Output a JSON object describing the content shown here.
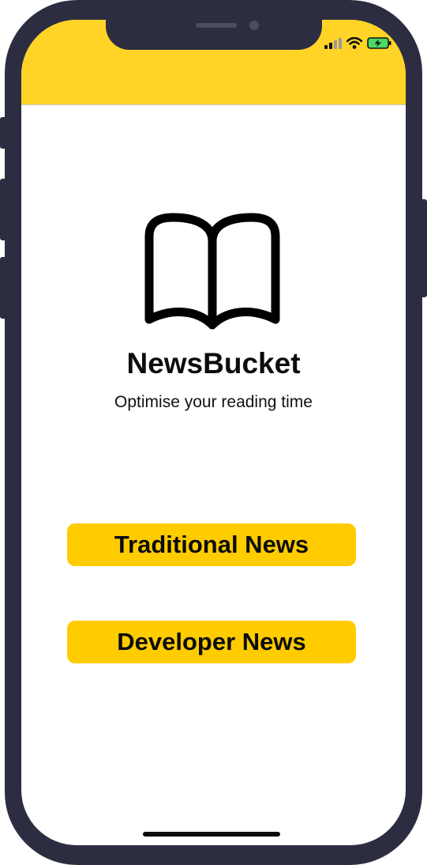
{
  "app": {
    "title": "NewsBucket",
    "tagline": "Optimise your reading time",
    "logo_icon": "open-book-icon"
  },
  "status_bar": {
    "signal_icon": "cellular-signal-icon",
    "wifi_icon": "wifi-icon",
    "battery_icon": "battery-charging-icon"
  },
  "actions": {
    "traditional_label": "Traditional News",
    "developer_label": "Developer News"
  },
  "colors": {
    "header": "#ffd426",
    "button": "#ffcc00",
    "device_frame": "#2d2d42",
    "battery": "#4cd964"
  }
}
